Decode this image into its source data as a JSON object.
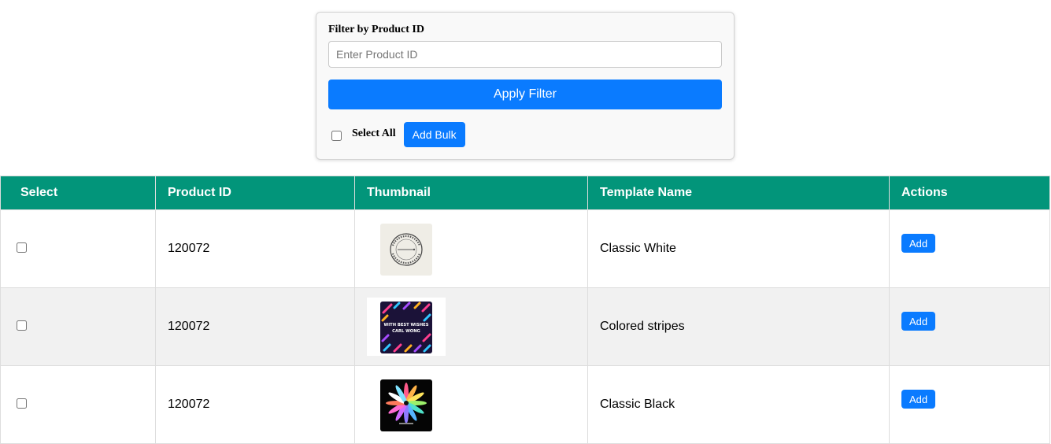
{
  "filter": {
    "label": "Filter by Product ID",
    "input_value": "",
    "input_placeholder": "Enter Product ID",
    "apply_label": "Apply Filter",
    "select_all_label": "Select All",
    "add_bulk_label": "Add Bulk"
  },
  "table": {
    "headers": [
      "Select",
      "Product ID",
      "Thumbnail",
      "Template Name",
      "Actions"
    ],
    "header_color": "#02957a",
    "rows": [
      {
        "product_id": "120072",
        "thumbnail": "round-stamp-logo-thumbnail",
        "template_name": "Classic White",
        "action_label": "Add"
      },
      {
        "product_id": "120072",
        "thumbnail": "colored-stripes-thumbnail",
        "template_name": "Colored stripes",
        "action_label": "Add",
        "thumb_text_1": "WITH BEST WISHES",
        "thumb_text_2": "CARL WONG"
      },
      {
        "product_id": "120072",
        "thumbnail": "flower-petals-thumbnail",
        "template_name": "Classic Black",
        "action_label": "Add"
      }
    ]
  },
  "colors": {
    "primary_button": "#0a7bff",
    "alt_row": "#f1f1f1"
  }
}
